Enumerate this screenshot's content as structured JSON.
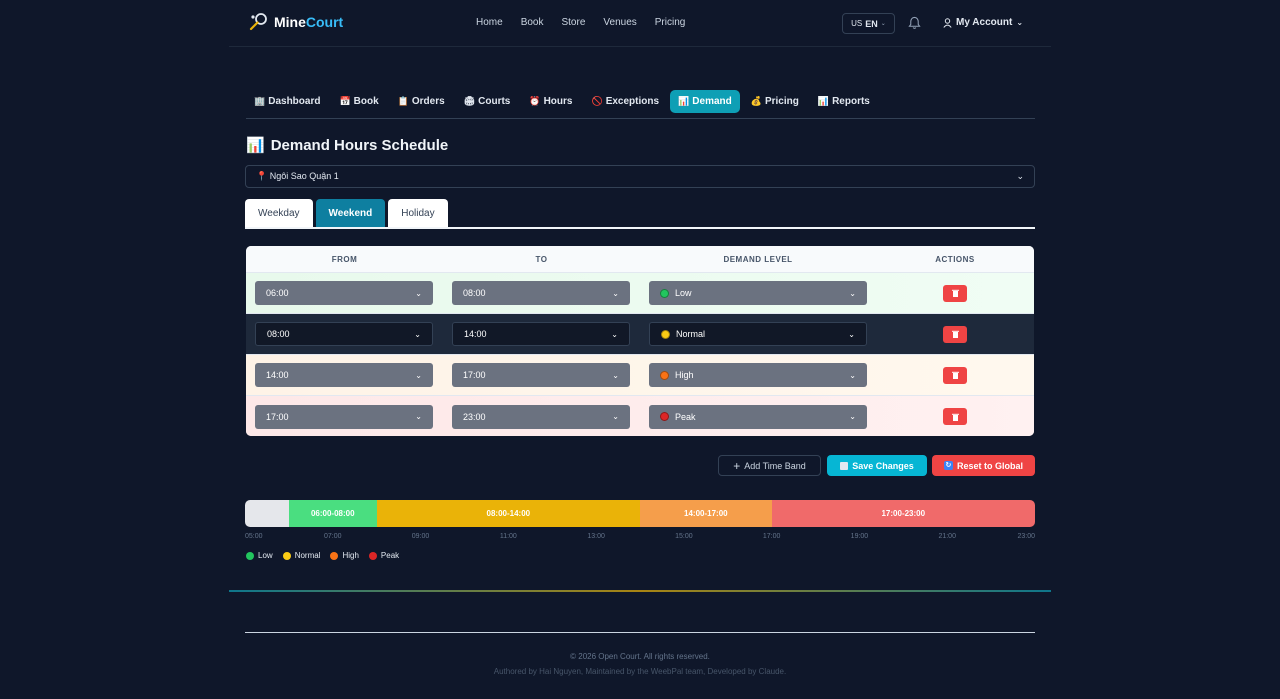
{
  "brand": {
    "name_part1": "Mine",
    "name_part2": "Court",
    "logo_icon": "racket-icon"
  },
  "nav": {
    "items": [
      "Home",
      "Book",
      "Store",
      "Venues",
      "Pricing"
    ]
  },
  "lang": {
    "flag": "US",
    "code": "EN"
  },
  "account": {
    "label": "My Account"
  },
  "subnav": {
    "items": [
      {
        "icon": "🏢",
        "label": "Dashboard"
      },
      {
        "icon": "📅",
        "label": "Book"
      },
      {
        "icon": "📋",
        "label": "Orders"
      },
      {
        "icon": "🏟",
        "label": "Courts"
      },
      {
        "icon": "⏰",
        "label": "Hours"
      },
      {
        "icon": "🚫",
        "label": "Exceptions"
      },
      {
        "icon": "📊",
        "label": "Demand"
      },
      {
        "icon": "💰",
        "label": "Pricing"
      },
      {
        "icon": "📊",
        "label": "Reports"
      }
    ],
    "active_index": 6
  },
  "page": {
    "title_icon": "📊",
    "title": "Demand Hours Schedule"
  },
  "venue": {
    "selected": "📍 Ngôi Sao Quận 1"
  },
  "day_tabs": {
    "items": [
      "Weekday",
      "Weekend",
      "Holiday"
    ],
    "active_index": 1
  },
  "table": {
    "headers": [
      "FROM",
      "TO",
      "DEMAND LEVEL",
      "ACTIONS"
    ],
    "rows": [
      {
        "from": "06:00",
        "to": "08:00",
        "level": "Low",
        "color": "#22c55e"
      },
      {
        "from": "08:00",
        "to": "14:00",
        "level": "Normal",
        "color": "#facc15"
      },
      {
        "from": "14:00",
        "to": "17:00",
        "level": "High",
        "color": "#f97316"
      },
      {
        "from": "17:00",
        "to": "23:00",
        "level": "Peak",
        "color": "#dc2626"
      }
    ]
  },
  "actions": {
    "add": "Add Time Band",
    "save": "Save Changes",
    "reset": "Reset to Global"
  },
  "timeline": {
    "segments": [
      {
        "label": "",
        "color": "#e5e7eb",
        "start": "05:00",
        "end": "06:00"
      },
      {
        "label": "06:00-08:00",
        "color": "#4ade80",
        "start": "06:00",
        "end": "08:00"
      },
      {
        "label": "08:00-14:00",
        "color": "#eab308",
        "start": "08:00",
        "end": "14:00"
      },
      {
        "label": "14:00-17:00",
        "color": "#f59e4b",
        "start": "14:00",
        "end": "17:00"
      },
      {
        "label": "17:00-23:00",
        "color": "#f06a6a",
        "start": "17:00",
        "end": "23:00"
      }
    ],
    "ticks": [
      "05:00",
      "07:00",
      "09:00",
      "11:00",
      "13:00",
      "15:00",
      "17:00",
      "19:00",
      "21:00",
      "23:00"
    ]
  },
  "legend": [
    {
      "label": "Low",
      "color": "#22c55e"
    },
    {
      "label": "Normal",
      "color": "#facc15"
    },
    {
      "label": "High",
      "color": "#f97316"
    },
    {
      "label": "Peak",
      "color": "#dc2626"
    }
  ],
  "footer": {
    "copyright": "© 2026 Open Court. All rights reserved.",
    "credits": "Authored by Hai Nguyen, Maintained by the WeebPal team, Developed by Claude."
  }
}
